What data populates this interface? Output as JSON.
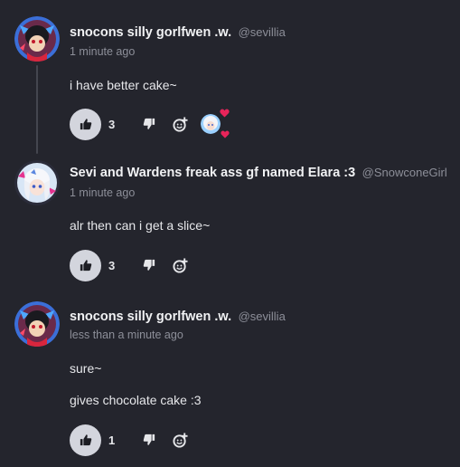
{
  "comments": [
    {
      "author": "snocons silly gorlfwen .w.",
      "handle": "@sevillia",
      "time": "1 minute ago",
      "lines": [
        "i have better cake~"
      ],
      "likes": "3",
      "avatar_icon": "avatar-dark-character",
      "reaction_icon": "reaction-avatar-heart"
    },
    {
      "author": "Sevi and Wardens freak ass gf named Elara :3",
      "handle": "@SnowconeGirl",
      "time": "1 minute ago",
      "lines": [
        "alr then can i get a slice~"
      ],
      "likes": "3",
      "avatar_icon": "avatar-white-hair-character"
    },
    {
      "author": "snocons silly gorlfwen .w.",
      "handle": "@sevillia",
      "time": "less than a minute ago",
      "lines": [
        "sure~",
        "gives chocolate cake :3"
      ],
      "likes": "1",
      "avatar_icon": "avatar-dark-character"
    }
  ],
  "colors": {
    "background": "#24252d",
    "like_button_bg": "#d3d5dd",
    "muted_text": "#8d8f99",
    "heart": "#e8245a"
  }
}
